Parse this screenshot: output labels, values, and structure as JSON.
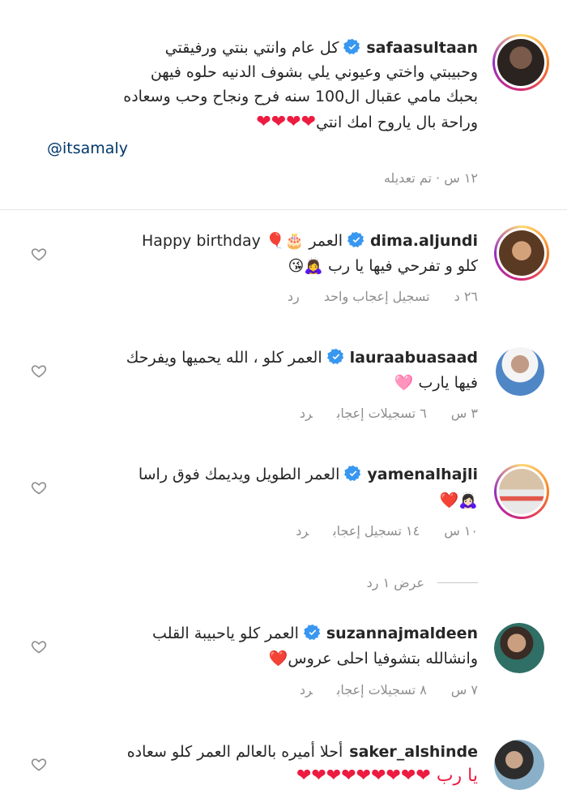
{
  "caption": {
    "username": "safaasultaan",
    "lines": [
      "كل عام وانتي بنتي ورفيقتي",
      "وحبيبتي واختي وعيوني يلي بشوف الدنيه حلوه فيهن",
      "بحبك مامي عقبال ال100 سنه فرح ونجاح وحب وسعاده",
      "وراحة بال ياروح امك انتي"
    ],
    "hearts": "❤❤❤❤",
    "mention": "@itsamaly",
    "meta": "١٢ س · تم تعديله"
  },
  "comments": [
    {
      "username": "dima.aljundi",
      "line1": "العمر 🎂🎈 Happy birthday",
      "line2": "كلو و تفرحي فيها يا رب 🙇‍♀️😘",
      "time": "٢٦ د",
      "likes": "تسجيل إعجاب واحد",
      "reply": "رد"
    },
    {
      "username": "lauraabuasaad",
      "line1": "العمر كلو ، الله يحميها ويفرحك",
      "line2": "فيها يارب 🩷",
      "time": "٣ س",
      "likes": "٦ تسجيلات إعجاب",
      "reply": "رد"
    },
    {
      "username": "yamenalhajli",
      "line1": "العمر الطويل ويديمك فوق راسا",
      "line2": "🙇🏻‍♀️❤️",
      "time": "١٠ س",
      "likes": "١٤ تسجيل إعجاب",
      "reply": "رد"
    },
    {
      "username": "suzannajmaldeen",
      "line1": "العمر كلو ياحبيبة القلب",
      "line2": "وانشالله بتشوفيا احلى عروس❤️",
      "time": "٧ س",
      "likes": "٨ تسجيلات إعجاب",
      "reply": "رد"
    },
    {
      "username": "saker_alshinde",
      "line1": "أحلا أميره بالعالم العمر كلو سعاده",
      "line2": "يا رب ❤❤❤❤❤❤❤❤❤",
      "time": "",
      "likes": "",
      "reply": ""
    }
  ],
  "view_replies": "عرض ١ رد",
  "colors": {
    "text": "#262626",
    "meta": "#8e8e8e",
    "mention": "#00376b",
    "verified": "#3897f0",
    "heart": "#ed1b40"
  }
}
